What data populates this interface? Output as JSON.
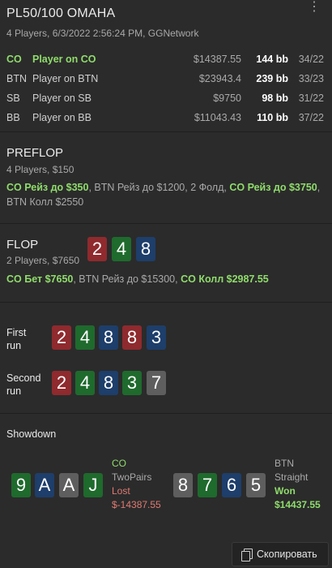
{
  "header": {
    "title": "PL50/100 OMAHA",
    "subtitle": "4 Players, 6/3/2022 2:56:24 PM, GGNetwork",
    "menu_icon": "⋮"
  },
  "players": [
    {
      "pos": "CO",
      "name": "Player on CO",
      "stack": "$14387.55",
      "bb": "144 bb",
      "hands": "34/22"
    },
    {
      "pos": "BTN",
      "name": "Player on BTN",
      "stack": "$23943.4",
      "bb": "239 bb",
      "hands": "33/23"
    },
    {
      "pos": "SB",
      "name": "Player on SB",
      "stack": "$9750",
      "bb": "98 bb",
      "hands": "31/22"
    },
    {
      "pos": "BB",
      "name": "Player on BB",
      "stack": "$11043.43",
      "bb": "110 bb",
      "hands": "37/22"
    }
  ],
  "preflop": {
    "title": "PREFLOP",
    "sub": "4 Players, $150",
    "a1": "CO Рейз до $350",
    "a2": ", BTN Рейз до $1200, 2 Фолд, ",
    "a3": "CO Рейз до $3750",
    "a4": ", BTN Колл $2550"
  },
  "flop": {
    "title": "FLOP",
    "sub": "2 Players, $7650",
    "cards": [
      "2",
      "4",
      "8"
    ],
    "a1": "CO Бет $7650",
    "a2": ", BTN Рейз до $15300, ",
    "a3": "CO Колл $2987.55"
  },
  "runs": [
    {
      "label1": "First",
      "label2": "run",
      "cards": [
        "2",
        "4",
        "8",
        "8",
        "3"
      ]
    },
    {
      "label1": "Second",
      "label2": "run",
      "cards": [
        "2",
        "4",
        "8",
        "3",
        "7"
      ]
    }
  ],
  "showdown": {
    "title": "Showdown",
    "hero": {
      "cards": [
        "9",
        "A",
        "A",
        "J"
      ],
      "pos": "CO",
      "hand": "TwoPairs",
      "result": "Lost",
      "amount": "$-14387.55"
    },
    "villain": {
      "cards": [
        "8",
        "7",
        "6",
        "5"
      ],
      "pos": "BTN",
      "hand": "Straight",
      "result": "Won",
      "amount": "$14437.55"
    }
  },
  "copy_button": {
    "label": "Скопировать"
  },
  "colors": {
    "background": "#2b2b2b",
    "green_text": "#8fdc6b",
    "red_text": "#e07a72",
    "card_red": "#8f2a2e",
    "card_blue": "#1e3e6b",
    "card_green": "#1f6a2d",
    "card_gray": "#5e5e5e"
  }
}
